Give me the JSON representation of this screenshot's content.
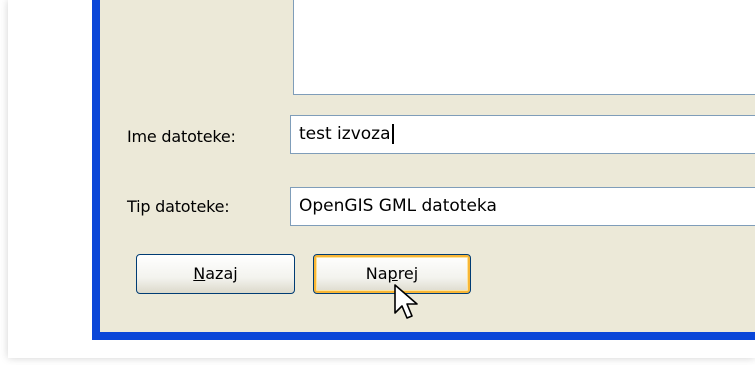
{
  "dialog": {
    "file_name_label": "Ime datoteke:",
    "file_name_value": "test izvoza",
    "file_type_label": "Tip datoteke:",
    "file_type_value": "OpenGIS GML datoteka",
    "back_button": {
      "underlined": "N",
      "rest": "azaj"
    },
    "next_button": {
      "before": "Na",
      "underlined": "p",
      "rest": "rej"
    }
  },
  "colors": {
    "window_border": "#0a46d8",
    "dialog_bg": "#ece9d8",
    "field_border": "#7f9db9",
    "hover_accent": "#f8b636"
  },
  "icons": {
    "cursor": "mouse-pointer-icon"
  }
}
